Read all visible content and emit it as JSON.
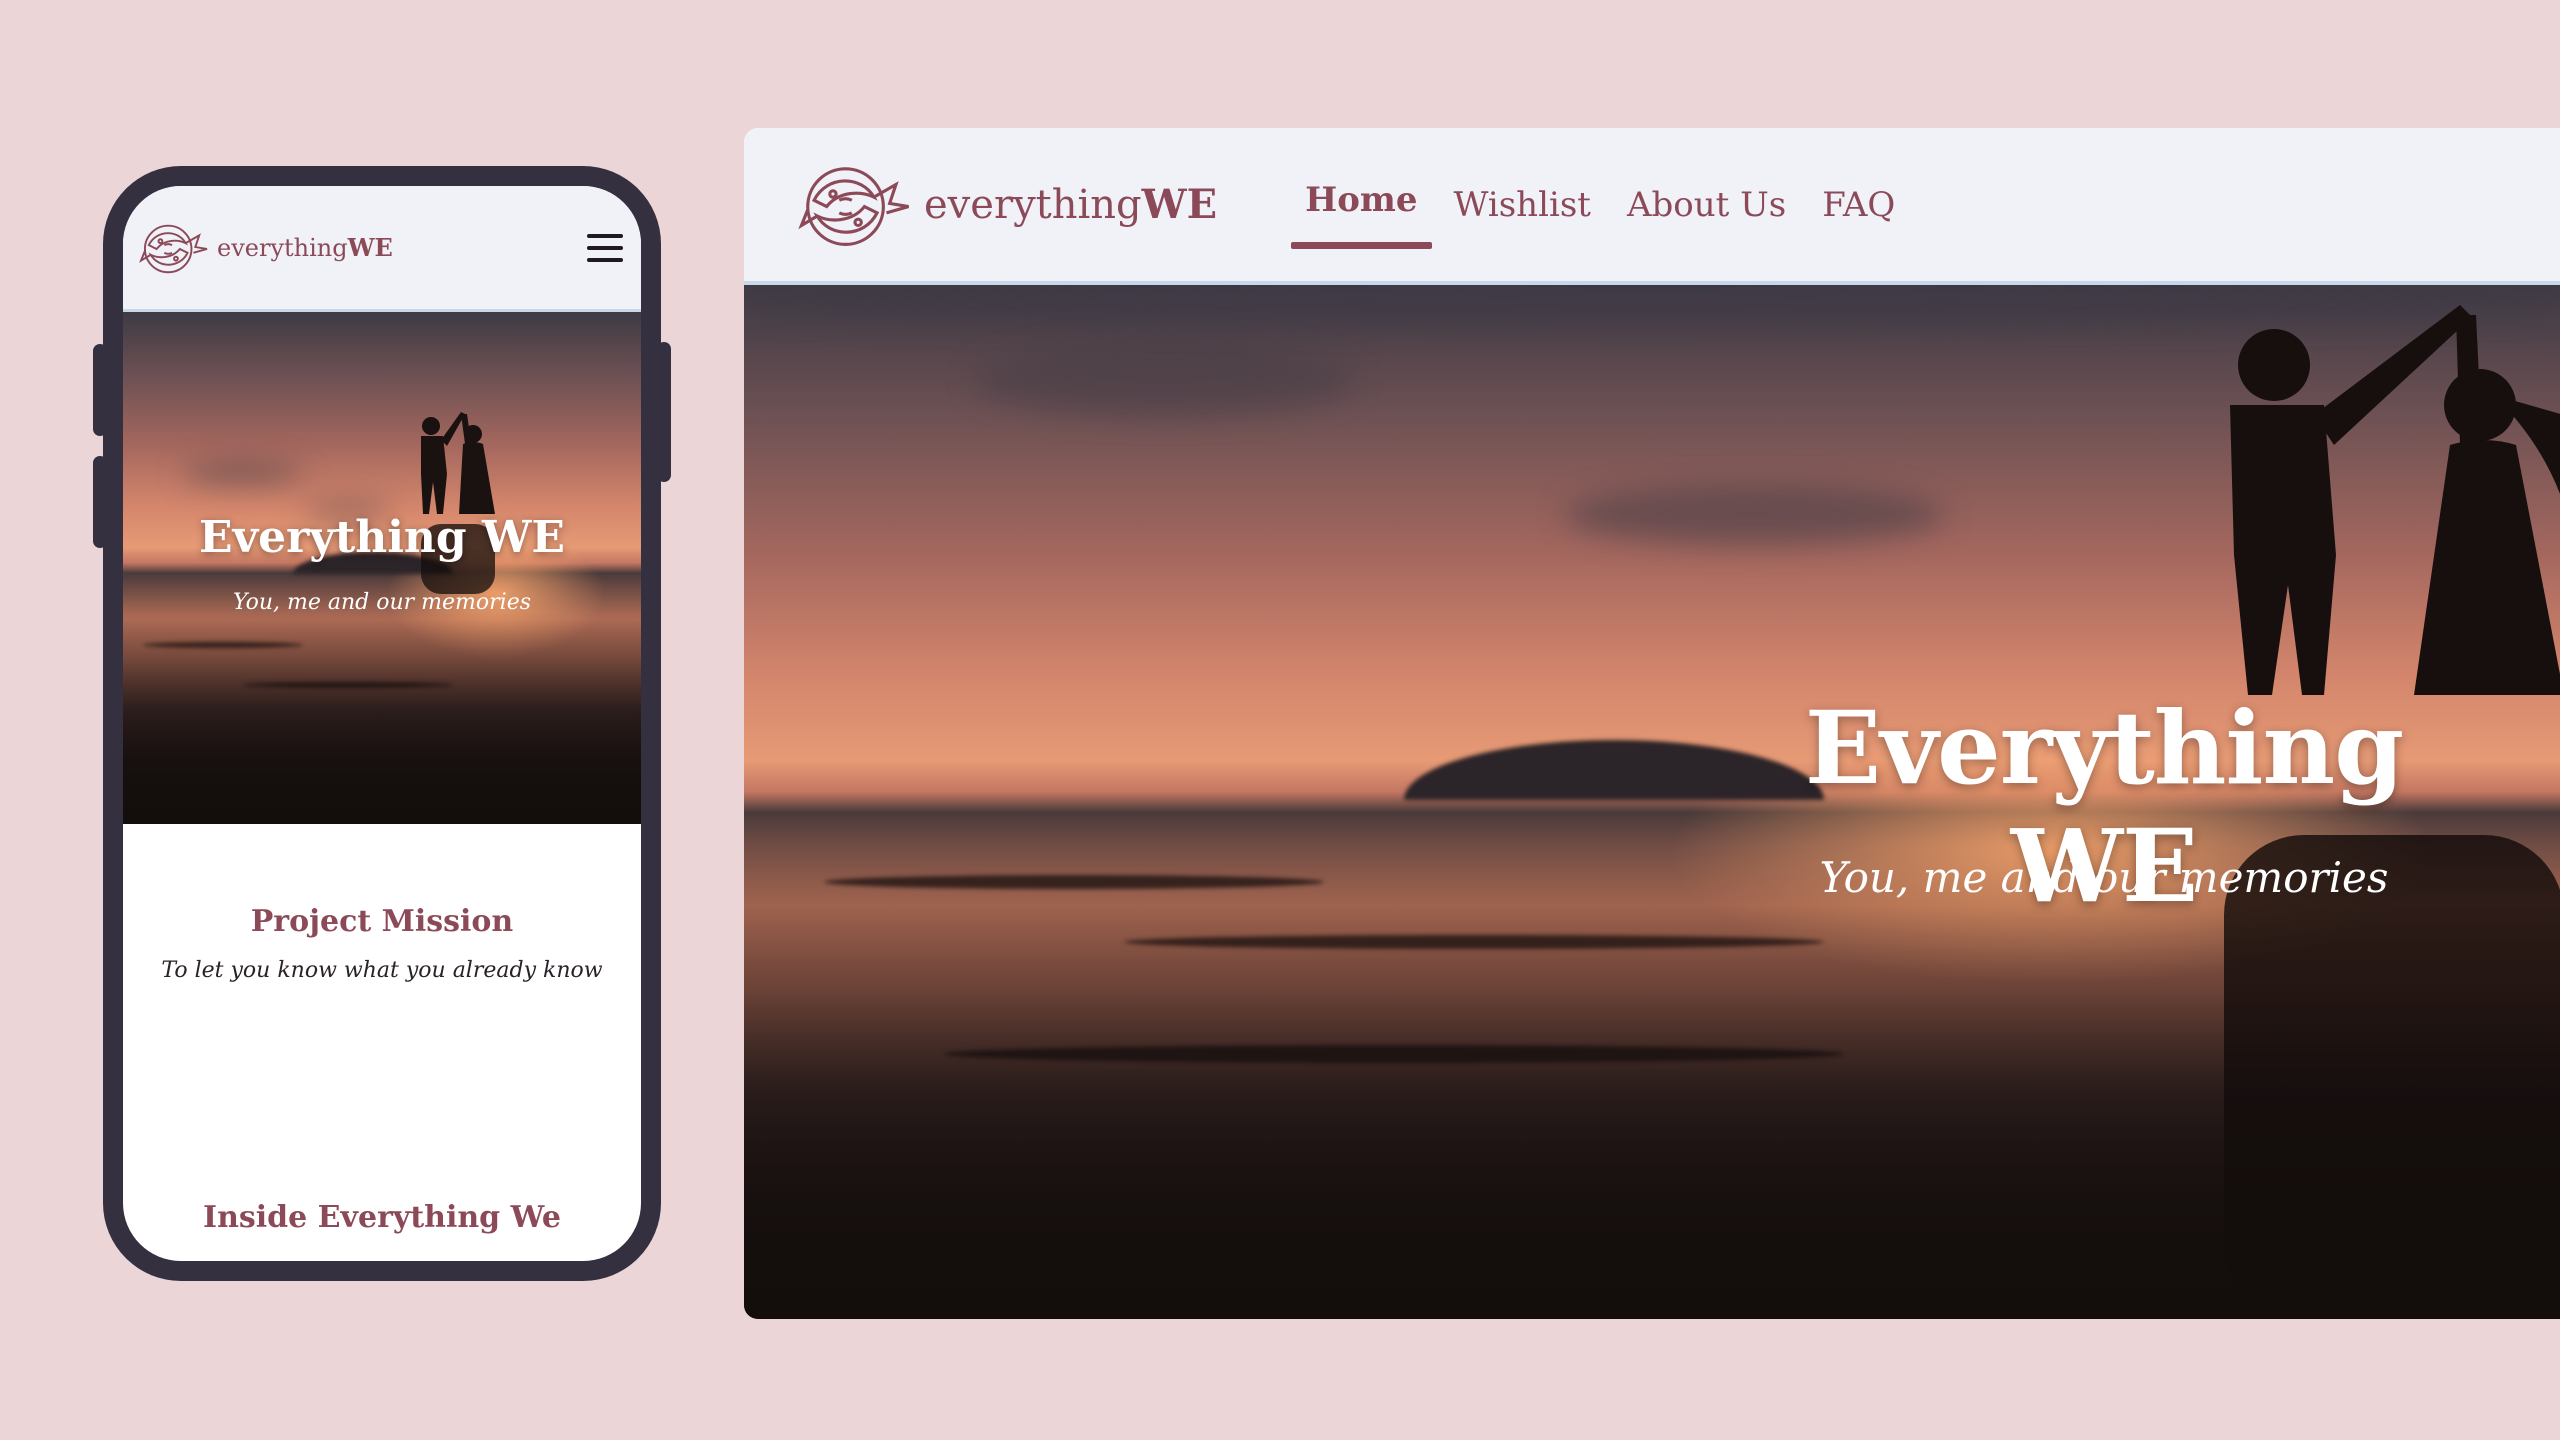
{
  "brand": {
    "prefix": "everything",
    "suffix": "WE",
    "color": "#8c4a58"
  },
  "colors": {
    "page_background": "#ecd5d6",
    "header_background": "#f0f2f8",
    "phone_frame": "#34303f",
    "accent": "#8c4a58"
  },
  "icons": {
    "logo": "koi-fish-logo-icon",
    "menu": "hamburger-menu-icon"
  },
  "desktop": {
    "nav": [
      {
        "label": "Home",
        "active": true
      },
      {
        "label": "Wishlist",
        "active": false
      },
      {
        "label": "About Us",
        "active": false
      },
      {
        "label": "FAQ",
        "active": false
      }
    ],
    "hero": {
      "title": "Everything WE",
      "subtitle": "You, me and our memories"
    }
  },
  "mobile": {
    "hero": {
      "title": "Everything WE",
      "subtitle": "You, me and our memories"
    },
    "mission": {
      "title": "Project Mission",
      "text": "To let you know what you already know"
    },
    "inside": {
      "title": "Inside Everything We"
    }
  }
}
